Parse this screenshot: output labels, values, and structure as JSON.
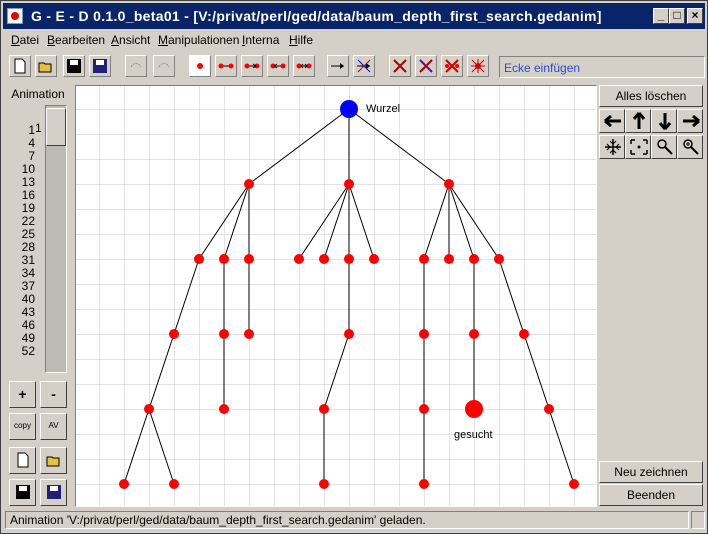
{
  "window": {
    "title": "G - E - D   0.1.0_beta01   -   [V:/privat/perl/ged/data/baum_depth_first_search.gedanim]"
  },
  "menu": [
    {
      "label": "Datei",
      "u": "D",
      "rest": "atei"
    },
    {
      "label": "Bearbeiten",
      "u": "B",
      "rest": "earbeiten"
    },
    {
      "label": "Ansicht",
      "u": "A",
      "rest": "nsicht"
    },
    {
      "label": "Manipulationen",
      "u": "M",
      "rest": "anipulationen"
    },
    {
      "label": "Interna",
      "u": "I",
      "rest": "nterna"
    },
    {
      "label": "Hilfe",
      "u": "H",
      "rest": "ilfe"
    }
  ],
  "toolbar": {
    "status": "Ecke einfügen"
  },
  "left_panel": {
    "animation_label": "Animation",
    "frames": [
      "1",
      "4",
      "7",
      "10",
      "13",
      "16",
      "19",
      "22",
      "25",
      "28",
      "31",
      "34",
      "37",
      "40",
      "43",
      "46",
      "49",
      "52"
    ],
    "slider_value": "1",
    "plus": "+",
    "minus": "-",
    "copy": "copy",
    "av": "AV"
  },
  "right_panel": {
    "clear_all": "Alles löschen",
    "redraw": "Neu zeichnen",
    "quit": "Beenden"
  },
  "graph": {
    "root_label": "Wurzel",
    "target_label": "gesucht",
    "node_color": "#ff0000",
    "root_color": "#0000ff"
  },
  "statusbar": {
    "text": "Animation 'V:/privat/perl/ged/data/baum_depth_first_search.gedanim' geladen."
  }
}
